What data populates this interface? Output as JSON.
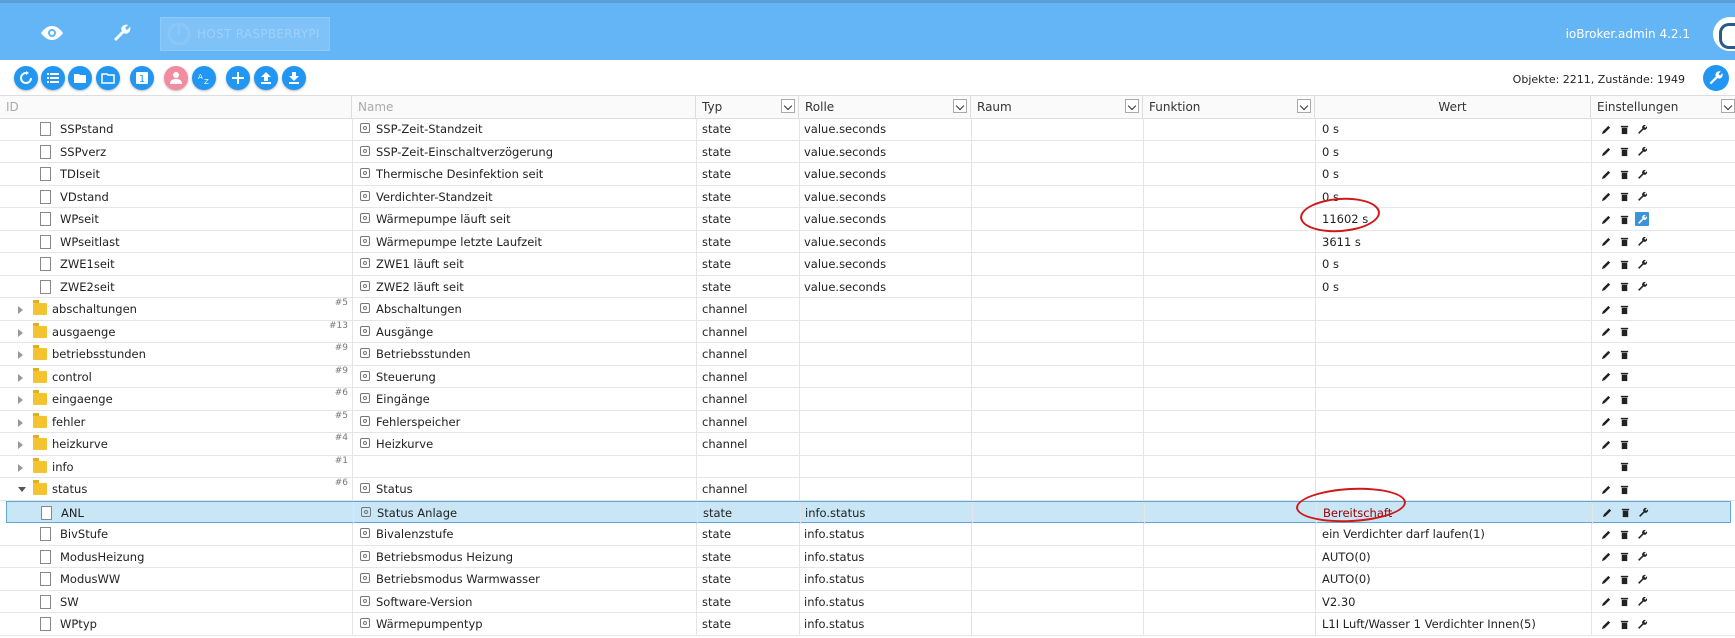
{
  "header": {
    "host_label": "HOST RASPBERRYPI",
    "version": "ioBroker.admin 4.2.1"
  },
  "toolbar": {
    "object_count": "Objekte: 2211, Zustände: 1949"
  },
  "columns": {
    "id": "ID",
    "name": "Name",
    "type": "Typ",
    "role": "Rolle",
    "room": "Raum",
    "function": "Funktion",
    "value": "Wert",
    "settings": "Einstellungen"
  },
  "rows": [
    {
      "id": "SSPstand",
      "count": "",
      "name": "SSP-Zeit-Standzeit",
      "type": "state",
      "role": "value.seconds",
      "value": "0 s",
      "kind": "state",
      "level": 2
    },
    {
      "id": "SSPverz",
      "count": "",
      "name": "SSP-Zeit-Einschaltverzögerung",
      "type": "state",
      "role": "value.seconds",
      "value": "0 s",
      "kind": "state",
      "level": 2
    },
    {
      "id": "TDIseit",
      "count": "",
      "name": "Thermische Desinfektion seit",
      "type": "state",
      "role": "value.seconds",
      "value": "0 s",
      "kind": "state",
      "level": 2
    },
    {
      "id": "VDstand",
      "count": "",
      "name": "Verdichter-Standzeit",
      "type": "state",
      "role": "value.seconds",
      "value": "0 s",
      "kind": "state",
      "level": 2
    },
    {
      "id": "WPseit",
      "count": "",
      "name": "Wärmepumpe läuft seit",
      "type": "state",
      "role": "value.seconds",
      "value": "11602 s",
      "kind": "state",
      "level": 2
    },
    {
      "id": "WPseitlast",
      "count": "",
      "name": "Wärmepumpe letzte Laufzeit",
      "type": "state",
      "role": "value.seconds",
      "value": "3611 s",
      "kind": "state",
      "level": 2
    },
    {
      "id": "ZWE1seit",
      "count": "",
      "name": "ZWE1 läuft seit",
      "type": "state",
      "role": "value.seconds",
      "value": "0 s",
      "kind": "state",
      "level": 2
    },
    {
      "id": "ZWE2seit",
      "count": "",
      "name": "ZWE2 läuft seit",
      "type": "state",
      "role": "value.seconds",
      "value": "0 s",
      "kind": "state",
      "level": 2
    },
    {
      "id": "abschaltungen",
      "count": "#5",
      "name": "Abschaltungen",
      "type": "channel",
      "role": "",
      "value": "",
      "kind": "folder",
      "level": 1
    },
    {
      "id": "ausgaenge",
      "count": "#13",
      "name": "Ausgänge",
      "type": "channel",
      "role": "",
      "value": "",
      "kind": "folder",
      "level": 1
    },
    {
      "id": "betriebsstunden",
      "count": "#9",
      "name": "Betriebsstunden",
      "type": "channel",
      "role": "",
      "value": "",
      "kind": "folder",
      "level": 1
    },
    {
      "id": "control",
      "count": "#9",
      "name": "Steuerung",
      "type": "channel",
      "role": "",
      "value": "",
      "kind": "folder",
      "level": 1
    },
    {
      "id": "eingaenge",
      "count": "#6",
      "name": "Eingänge",
      "type": "channel",
      "role": "",
      "value": "",
      "kind": "folder",
      "level": 1
    },
    {
      "id": "fehler",
      "count": "#5",
      "name": "Fehlerspeicher",
      "type": "channel",
      "role": "",
      "value": "",
      "kind": "folder",
      "level": 1
    },
    {
      "id": "heizkurve",
      "count": "#4",
      "name": "Heizkurve",
      "type": "channel",
      "role": "",
      "value": "",
      "kind": "folder",
      "level": 1
    },
    {
      "id": "info",
      "count": "#1",
      "name": "",
      "type": "",
      "role": "",
      "value": "",
      "kind": "folder",
      "level": 1
    },
    {
      "id": "status",
      "count": "#6",
      "name": "Status",
      "type": "channel",
      "role": "",
      "value": "",
      "kind": "folder-open",
      "level": 1
    },
    {
      "id": "ANL",
      "count": "",
      "name": "Status Anlage",
      "type": "state",
      "role": "info.status",
      "value": "Bereitschaft",
      "kind": "state",
      "level": 2,
      "selected": true
    },
    {
      "id": "BivStufe",
      "count": "",
      "name": "Bivalenzstufe",
      "type": "state",
      "role": "info.status",
      "value": "ein Verdichter darf laufen(1)",
      "kind": "state",
      "level": 2
    },
    {
      "id": "ModusHeizung",
      "count": "",
      "name": "Betriebsmodus Heizung",
      "type": "state",
      "role": "info.status",
      "value": "AUTO(0)",
      "kind": "state",
      "level": 2
    },
    {
      "id": "ModusWW",
      "count": "",
      "name": "Betriebsmodus Warmwasser",
      "type": "state",
      "role": "info.status",
      "value": "AUTO(0)",
      "kind": "state",
      "level": 2
    },
    {
      "id": "SW",
      "count": "",
      "name": "Software-Version",
      "type": "state",
      "role": "info.status",
      "value": "V2.30",
      "kind": "state",
      "level": 2
    },
    {
      "id": "WPtyp",
      "count": "",
      "name": "Wärmepumpentyp",
      "type": "state",
      "role": "info.status",
      "value": "L1I Luft/Wasser 1 Verdichter Innen(5)",
      "kind": "state",
      "level": 2
    }
  ],
  "highlight_color": "#d01818",
  "accent": "#2196f3"
}
